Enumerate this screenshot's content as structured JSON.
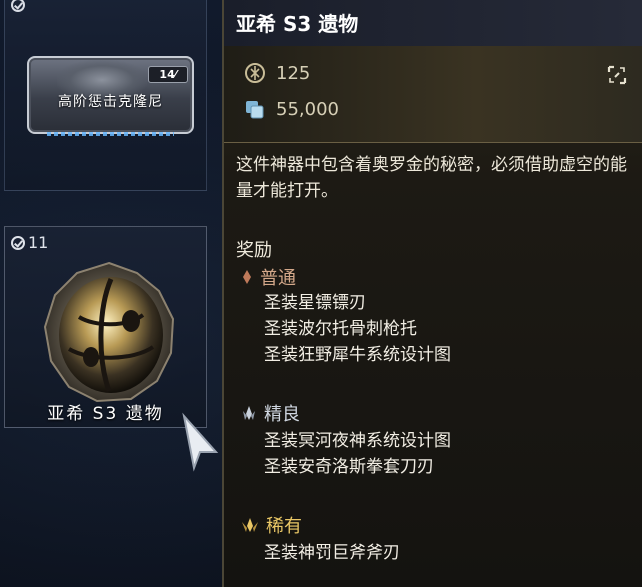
{
  "inventory": {
    "blueprint_card": {
      "name": "高阶惩击克隆尼",
      "tag": "14"
    },
    "relic_card": {
      "count": "11",
      "name": "亚希 S3 遗物"
    }
  },
  "tooltip": {
    "title": "亚希 S3 遗物",
    "stats": {
      "ducats": "125",
      "credits": "55,000"
    },
    "description": "这件神器中包含着奥罗金的秘密，必须借助虚空的能量才能打开。",
    "rewards_heading": "奖励",
    "tiers": [
      {
        "name": "普通",
        "color": "#d4a88a",
        "items": [
          "圣装星镖镖刃",
          "圣装波尔托骨刺枪托",
          "圣装狂野犀牛系统设计图"
        ]
      },
      {
        "name": "精良",
        "color": "#cfd6e0",
        "items": [
          "圣装冥河夜神系统设计图",
          "圣装安奇洛斯拳套刀刃"
        ]
      },
      {
        "name": "稀有",
        "color": "#e9c766",
        "items": [
          "圣装神罚巨斧斧刃"
        ]
      }
    ]
  }
}
